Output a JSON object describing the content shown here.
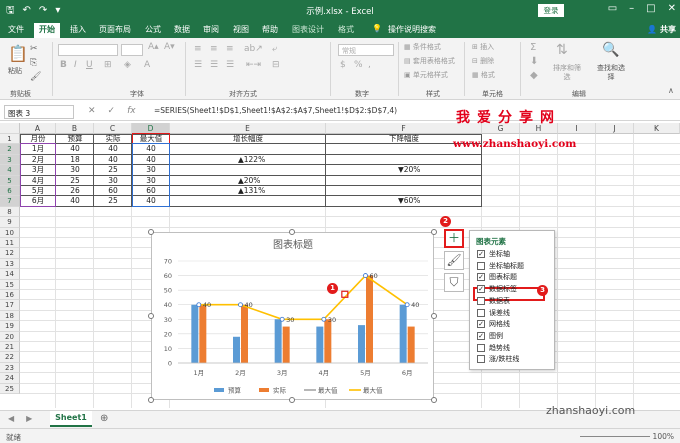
{
  "titlebar": {
    "title": "示例.xlsx  -  Excel",
    "login": "登录"
  },
  "tabs": [
    {
      "label": "文件"
    },
    {
      "label": "开始",
      "active": true
    },
    {
      "label": "插入"
    },
    {
      "label": "页面布局"
    },
    {
      "label": "公式"
    },
    {
      "label": "数据"
    },
    {
      "label": "审阅"
    },
    {
      "label": "视图"
    },
    {
      "label": "帮助"
    },
    {
      "label": "图表设计",
      "ctx": true
    },
    {
      "label": "格式",
      "ctx": true
    },
    {
      "label": "操作说明搜索"
    }
  ],
  "share": "共享",
  "ribbon": {
    "groups": [
      "剪贴板",
      "字体",
      "对齐方式",
      "数字",
      "样式",
      "单元格",
      "编辑"
    ],
    "font_box": "",
    "number_format": "常规",
    "cond_format": "条件格式",
    "table_format": "套用表格格式",
    "cell_style": "单元格样式",
    "insert": "插入",
    "delete": "删除",
    "format": "格式",
    "sort_filter": "排序和筛选",
    "find_select": "查找和选择",
    "paste": "粘贴"
  },
  "formula_bar": {
    "name_box": "图表 3",
    "formula": "=SERIES(Sheet1!$D$1,Sheet1!$A$2:$A$7,Sheet1!$D$2:$D$7,4)"
  },
  "watermark": {
    "cn": "我爱分享网",
    "url": "www.zhanshaoyi.com",
    "footer": "zhanshaoyi.com"
  },
  "columns": [
    "A",
    "B",
    "C",
    "D",
    "E",
    "F",
    "G",
    "H",
    "I",
    "J",
    "K"
  ],
  "rows": [
    "1",
    "2",
    "3",
    "4",
    "5",
    "6",
    "7",
    "8",
    "9",
    "10",
    "11",
    "12",
    "13",
    "14",
    "15",
    "16",
    "17",
    "18",
    "19",
    "20",
    "21",
    "22",
    "23",
    "24",
    "25"
  ],
  "table": {
    "headers": [
      "月份",
      "预算",
      "实际",
      "最大值",
      "增长幅度",
      "下降幅度"
    ],
    "rows": [
      {
        "month": "1月",
        "budget": "40",
        "actual": "40",
        "max": "40",
        "up": "",
        "down": ""
      },
      {
        "month": "2月",
        "budget": "18",
        "actual": "40",
        "max": "40",
        "up": "▲122%",
        "down": ""
      },
      {
        "month": "3月",
        "budget": "30",
        "actual": "25",
        "max": "30",
        "up": "",
        "down": "▼20%"
      },
      {
        "month": "4月",
        "budget": "25",
        "actual": "30",
        "max": "30",
        "up": "▲20%",
        "down": ""
      },
      {
        "month": "5月",
        "budget": "26",
        "actual": "60",
        "max": "60",
        "up": "▲131%",
        "down": ""
      },
      {
        "month": "6月",
        "budget": "40",
        "actual": "25",
        "max": "40",
        "up": "",
        "down": "▼60%"
      }
    ]
  },
  "chart_data": {
    "type": "bar",
    "title": "图表标题",
    "categories": [
      "1月",
      "2月",
      "3月",
      "4月",
      "5月",
      "6月"
    ],
    "series": [
      {
        "name": "预算",
        "type": "bar",
        "values": [
          40,
          18,
          30,
          25,
          26,
          40
        ],
        "color": "#5B9BD5"
      },
      {
        "name": "实际",
        "type": "bar",
        "values": [
          40,
          40,
          25,
          30,
          60,
          25
        ],
        "color": "#ED7D31"
      },
      {
        "name": "最大值",
        "type": "line",
        "values": [
          40,
          40,
          30,
          30,
          60,
          40
        ],
        "color": "#A5A5A5"
      },
      {
        "name": "最大值",
        "type": "line",
        "values": [
          40,
          40,
          30,
          30,
          60,
          40
        ],
        "color": "#FFC000",
        "data_labels": [
          "40",
          "40",
          "30",
          "30",
          "60",
          "40"
        ]
      }
    ],
    "ylim": [
      0,
      70
    ],
    "yticks": [
      "0",
      "10",
      "20",
      "30",
      "40",
      "50",
      "60",
      "70"
    ],
    "grid": true,
    "legend": "bottom"
  },
  "chart_elements_pane": {
    "title": "图表元素",
    "items": [
      {
        "label": "坐标轴",
        "checked": true
      },
      {
        "label": "坐标轴标题",
        "checked": false
      },
      {
        "label": "图表标题",
        "checked": true
      },
      {
        "label": "数据标签",
        "checked": true
      },
      {
        "label": "数据表",
        "checked": false
      },
      {
        "label": "误差线",
        "checked": false
      },
      {
        "label": "网格线",
        "checked": true
      },
      {
        "label": "图例",
        "checked": true
      },
      {
        "label": "趋势线",
        "checked": false
      },
      {
        "label": "涨/跌柱线",
        "checked": false
      }
    ]
  },
  "badges": [
    "1",
    "2",
    "3"
  ],
  "sheet_tab": "Sheet1",
  "status": {
    "ready": "就绪",
    "zoom": "100%"
  }
}
